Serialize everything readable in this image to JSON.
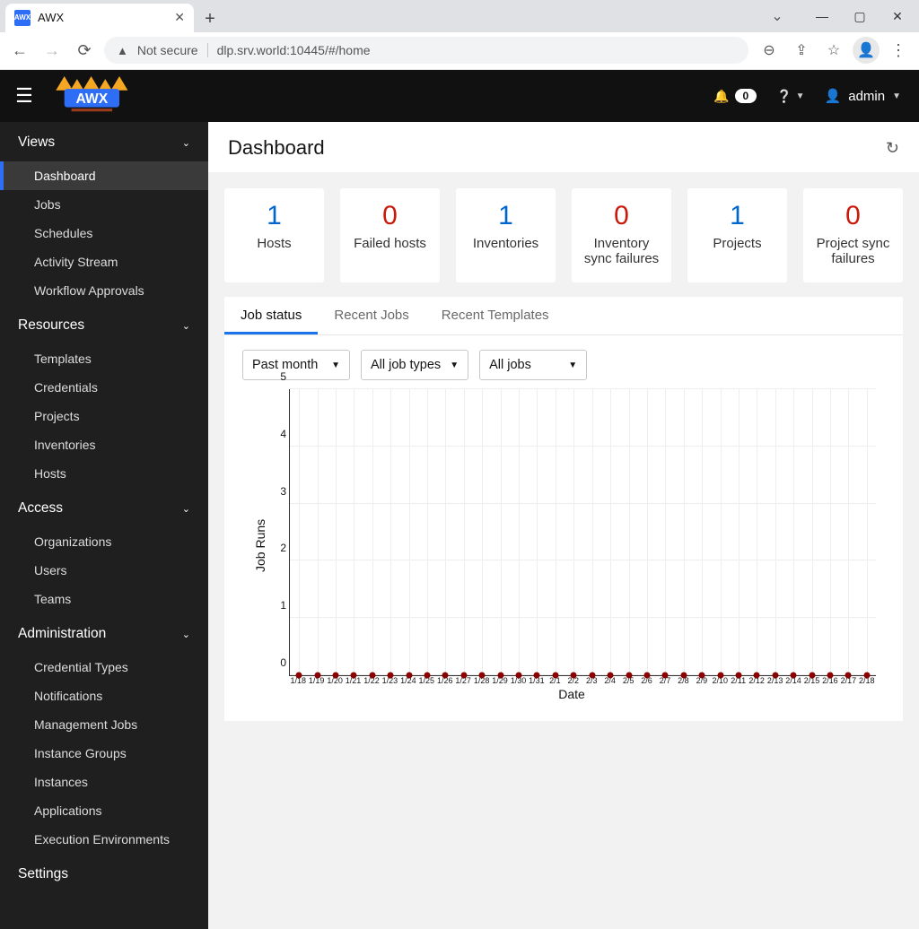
{
  "browser": {
    "tab_title": "AWX",
    "url_not_secure": "Not secure",
    "url_text": "dlp.srv.world:10445/#/home"
  },
  "topnav": {
    "notification_count": "0",
    "username": "admin"
  },
  "sidebar": {
    "sections": [
      {
        "title": "Views",
        "items": [
          "Dashboard",
          "Jobs",
          "Schedules",
          "Activity Stream",
          "Workflow Approvals"
        ],
        "active_index": 0
      },
      {
        "title": "Resources",
        "items": [
          "Templates",
          "Credentials",
          "Projects",
          "Inventories",
          "Hosts"
        ]
      },
      {
        "title": "Access",
        "items": [
          "Organizations",
          "Users",
          "Teams"
        ]
      },
      {
        "title": "Administration",
        "items": [
          "Credential Types",
          "Notifications",
          "Management Jobs",
          "Instance Groups",
          "Instances",
          "Applications",
          "Execution Environments"
        ]
      },
      {
        "title": "Settings",
        "items": []
      }
    ]
  },
  "dashboard": {
    "title": "Dashboard",
    "cards": [
      {
        "value": "1",
        "label": "Hosts",
        "color": "blue"
      },
      {
        "value": "0",
        "label": "Failed hosts",
        "color": "red"
      },
      {
        "value": "1",
        "label": "Inventories",
        "color": "blue"
      },
      {
        "value": "0",
        "label": "Inventory sync failures",
        "color": "red"
      },
      {
        "value": "1",
        "label": "Projects",
        "color": "blue"
      },
      {
        "value": "0",
        "label": "Project sync failures",
        "color": "red"
      }
    ],
    "tabs": [
      "Job status",
      "Recent Jobs",
      "Recent Templates"
    ],
    "active_tab": 0,
    "filters": [
      {
        "label": "Past month"
      },
      {
        "label": "All job types"
      },
      {
        "label": "All jobs"
      }
    ]
  },
  "chart_data": {
    "type": "line",
    "title": "",
    "xlabel": "Date",
    "ylabel": "Job Runs",
    "ylim": [
      0,
      5
    ],
    "yticks": [
      0,
      1,
      2,
      3,
      4,
      5
    ],
    "categories": [
      "1/18",
      "1/19",
      "1/20",
      "1/21",
      "1/22",
      "1/23",
      "1/24",
      "1/25",
      "1/26",
      "1/27",
      "1/28",
      "1/29",
      "1/30",
      "1/31",
      "2/1",
      "2/2",
      "2/3",
      "2/4",
      "2/5",
      "2/6",
      "2/7",
      "2/8",
      "2/9",
      "2/10",
      "2/11",
      "2/12",
      "2/13",
      "2/14",
      "2/15",
      "2/16",
      "2/17",
      "2/18"
    ],
    "values": [
      0,
      0,
      0,
      0,
      0,
      0,
      0,
      0,
      0,
      0,
      0,
      0,
      0,
      0,
      0,
      0,
      0,
      0,
      0,
      0,
      0,
      0,
      0,
      0,
      0,
      0,
      0,
      0,
      0,
      0,
      0,
      0
    ]
  }
}
